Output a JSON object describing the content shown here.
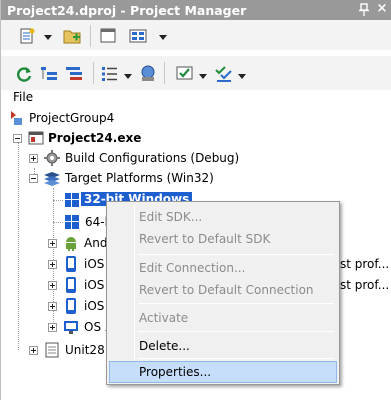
{
  "window": {
    "title": "Project24.dproj - Project Manager",
    "close_glyph": "×"
  },
  "toolbar1": {
    "buttons": [
      "new-item-icon",
      "add-folder-icon",
      "open-folder-icon",
      "view-grid-icon"
    ]
  },
  "toolbar2": {
    "buttons": [
      "sync-icon",
      "expand-icon",
      "collapse-icon",
      "list-icon",
      "network-icon",
      "build-check-icon",
      "build-all-icon"
    ]
  },
  "panel": {
    "file_label": "File"
  },
  "tree": {
    "group": "ProjectGroup4",
    "project": "Project24.exe",
    "build_configs": "Build Configurations (Debug)",
    "target_platforms": "Target Platforms (Win32)",
    "platforms": [
      {
        "label": "32-bit Windows",
        "icon": "windows-icon",
        "selected": true
      },
      {
        "label": "64-b",
        "icon": "windows-icon"
      },
      {
        "label": "And",
        "icon": "android-icon"
      },
      {
        "label": "iOS",
        "icon": "ios-device-icon",
        "trail": "st prof..."
      },
      {
        "label": "iOS",
        "icon": "ios-device-icon",
        "trail": "st prof..."
      },
      {
        "label": "iOS",
        "icon": "ios-device-icon"
      },
      {
        "label": "OS X",
        "icon": "osx-icon"
      }
    ],
    "unit": "Unit28."
  },
  "context_menu": {
    "items": [
      {
        "label": "Edit SDK...",
        "enabled": false
      },
      {
        "label": "Revert to Default SDK",
        "enabled": false
      },
      {
        "label": "Edit Connection...",
        "enabled": false
      },
      {
        "label": "Revert to Default Connection",
        "enabled": false
      },
      {
        "label": "Activate",
        "enabled": false
      },
      {
        "label": "Delete...",
        "enabled": true
      },
      {
        "label": "Properties...",
        "enabled": true,
        "hover": true
      }
    ]
  },
  "colors": {
    "titlebar": "#999999",
    "selection": "#1e5fd0",
    "menu_hover": "#c6defa"
  }
}
